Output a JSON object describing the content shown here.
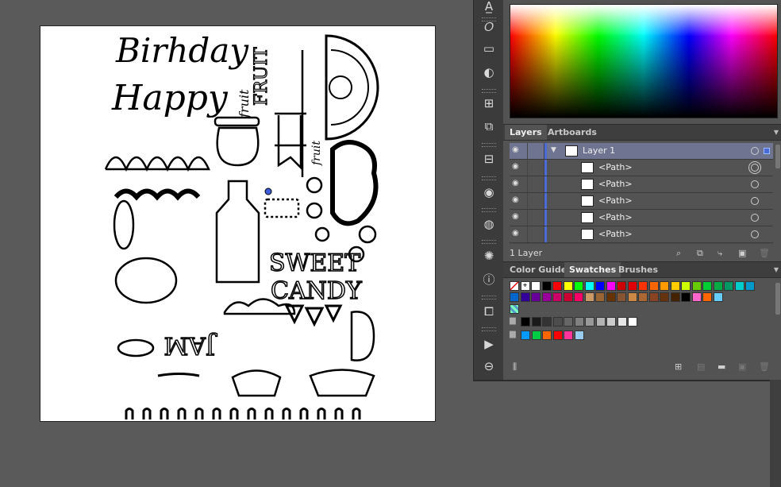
{
  "tools": [
    "type-on-path-icon",
    "warp-icon",
    "gradient-icon",
    "blend-icon",
    "transform-icon",
    "pathfinder-icon",
    "align-icon",
    "appearance-icon",
    "graphic-styles-icon",
    "symbols-icon",
    "info-icon",
    "artboard-nav-icon",
    "actions-icon",
    "links-icon"
  ],
  "layers_panel": {
    "tabs": [
      "Layers",
      "Artboards"
    ],
    "active_tab": "Layers",
    "rows": [
      {
        "name": "Layer 1",
        "selected": true
      },
      {
        "name": "<Path>",
        "selected": false
      },
      {
        "name": "<Path>",
        "selected": false
      },
      {
        "name": "<Path>",
        "selected": false
      },
      {
        "name": "<Path>",
        "selected": false
      },
      {
        "name": "<Path>",
        "selected": false
      }
    ],
    "count_label": "1 Layer"
  },
  "swatches_panel": {
    "tabs": [
      "Color Guide",
      "Swatches",
      "Brushes"
    ],
    "active_tab": "Swatches",
    "row1": [
      "#ffffff",
      "#000000",
      "#ff0000",
      "#ffff00",
      "#00ff00",
      "#00ffff",
      "#0000ff",
      "#ff00ff",
      "#cc0000",
      "#e00000",
      "#ff3300",
      "#ff6600",
      "#ff9900",
      "#ffcc00",
      "#ccff00",
      "#66cc00",
      "#00cc33",
      "#00aa44",
      "#009966",
      "#00cccc",
      "#0099cc"
    ],
    "row2": [
      "#0066cc",
      "#330099",
      "#660099",
      "#990099",
      "#cc0066",
      "#cc0033",
      "#ff0066",
      "#cc9966",
      "#996633",
      "#663300",
      "#885533",
      "#cc8844",
      "#aa6633",
      "#884422",
      "#663311",
      "#442200",
      "#000000",
      "#ff66cc",
      "#ff6600",
      "#66ccff"
    ],
    "row4": [
      "#000000",
      "#1a1a1a",
      "#333333",
      "#4d4d4d",
      "#666666",
      "#808080",
      "#999999",
      "#b3b3b3",
      "#cccccc",
      "#e6e6e6",
      "#ffffff"
    ],
    "row5": [
      "#0099ff",
      "#00cc44",
      "#ff6600",
      "#ff0000",
      "#ff3399",
      "#99ccee"
    ]
  },
  "artwork": {
    "lettering": [
      "Birhday",
      "Happy",
      "fruit",
      "FRUIT",
      "fruit",
      "SWEET",
      "CANDY",
      "JAM"
    ]
  }
}
